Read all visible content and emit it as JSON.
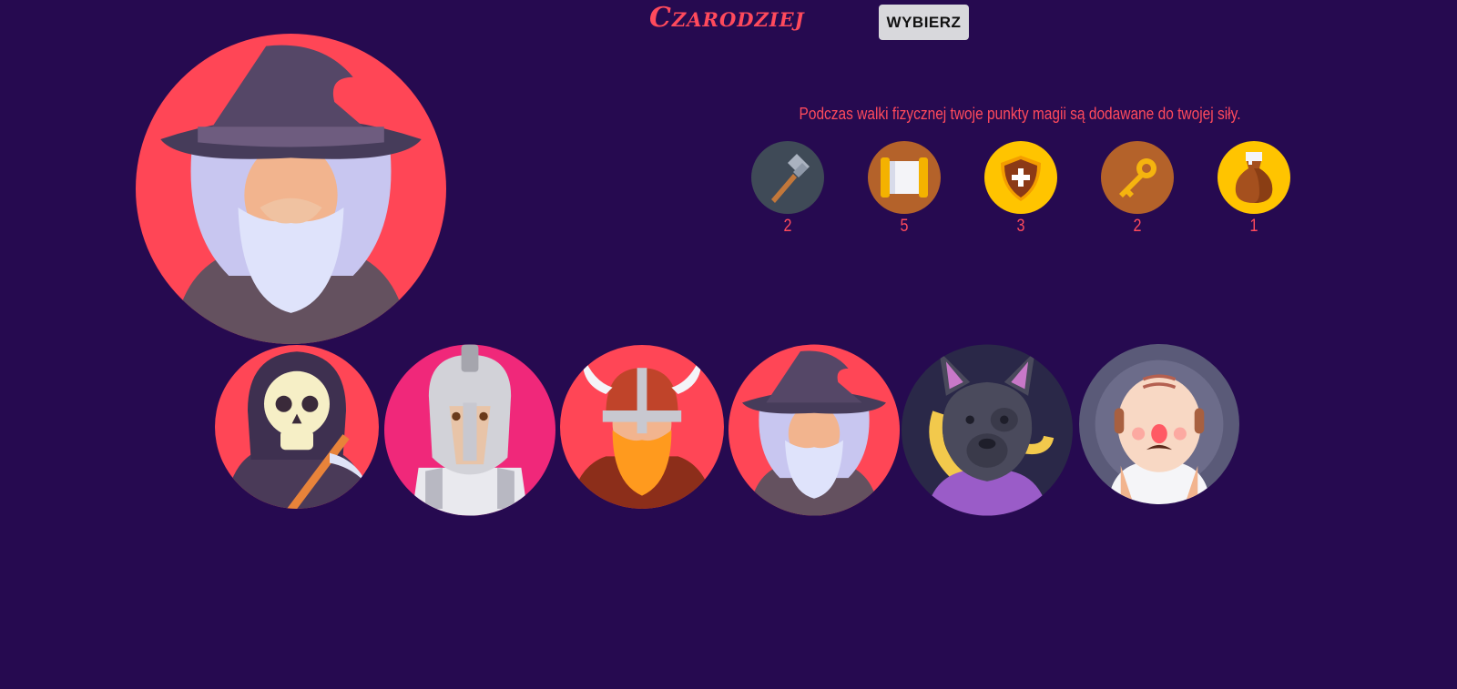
{
  "header": {
    "title": "Czarodziej",
    "choose_label": "Wybierz"
  },
  "selected": {
    "name": "Czarodziej",
    "description": "Podczas walki fizycznej twoje punkty magii są dodawane do twojej siły.",
    "portrait": "wizard-portrait"
  },
  "stats": [
    {
      "icon": "hammer-icon",
      "value": "2"
    },
    {
      "icon": "scroll-icon",
      "value": "5"
    },
    {
      "icon": "shield-icon",
      "value": "3"
    },
    {
      "icon": "key-icon",
      "value": "2"
    },
    {
      "icon": "money-bag-icon",
      "value": "1"
    }
  ],
  "characters": [
    {
      "icon": "grim-reaper-avatar"
    },
    {
      "icon": "spartan-knight-avatar"
    },
    {
      "icon": "viking-avatar"
    },
    {
      "icon": "wizard-avatar"
    },
    {
      "icon": "werewolf-avatar"
    },
    {
      "icon": "bald-man-avatar"
    }
  ],
  "colors": {
    "background": "#260a50",
    "accent": "#ff4a5c",
    "button": "#d8d8dc"
  }
}
